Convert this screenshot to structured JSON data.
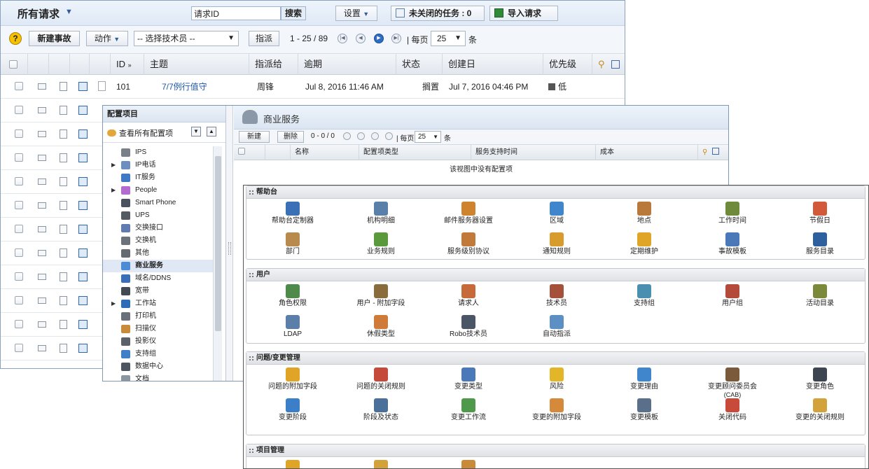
{
  "requests": {
    "title": "所有请求",
    "search_value": "请求ID",
    "search_button": "搜索",
    "settings_button": "设置",
    "tasks_button": "未关闭的任务 : 0",
    "import_button": "导入请求",
    "new_button": "新建事故",
    "action_button": "动作",
    "tech_select": "-- 选择技术员 --",
    "assign_button": "指派",
    "pager_range": "1 - 25 / 89",
    "per_page_label": "每页",
    "per_page_value": "25",
    "per_page_unit": "条",
    "columns": [
      "ID",
      "主题",
      "指派给",
      "逾期",
      "状态",
      "创建日",
      "优先级"
    ],
    "first_row": {
      "id": "101",
      "subject": "7/7例行值守",
      "assignee": "周锋",
      "due": "Jul 8, 2016 11:46 AM",
      "status": "搁置",
      "created": "Jul 7, 2016 04:46 PM",
      "priority": "低"
    },
    "row_count": 12
  },
  "ci": {
    "panel_title": "配置项目",
    "view_all": "查看所有配置项",
    "items": [
      {
        "label": "IPS",
        "expand": false,
        "color": "#7a7f88"
      },
      {
        "label": "IP电话",
        "expand": true,
        "color": "#6d8fbf"
      },
      {
        "label": "IT服务",
        "expand": false,
        "color": "#3d79c6"
      },
      {
        "label": "People",
        "expand": true,
        "color": "#b36ad1"
      },
      {
        "label": "Smart Phone",
        "expand": false,
        "color": "#4a5260"
      },
      {
        "label": "UPS",
        "expand": false,
        "color": "#555b63"
      },
      {
        "label": "交换接口",
        "expand": false,
        "color": "#5f7bb0"
      },
      {
        "label": "交换机",
        "expand": false,
        "color": "#6b727c"
      },
      {
        "label": "其他",
        "expand": false,
        "color": "#666b72"
      },
      {
        "label": "商业服务",
        "expand": false,
        "color": "#4c8bd6",
        "selected": true
      },
      {
        "label": "域名/DDNS",
        "expand": false,
        "color": "#3a6fb8"
      },
      {
        "label": "宽带",
        "expand": false,
        "color": "#444a52"
      },
      {
        "label": "工作站",
        "expand": true,
        "color": "#2f6cb8"
      },
      {
        "label": "打印机",
        "expand": false,
        "color": "#6a7079"
      },
      {
        "label": "扫描仪",
        "expand": false,
        "color": "#c98b3a"
      },
      {
        "label": "投影仪",
        "expand": false,
        "color": "#5b6169"
      },
      {
        "label": "支持组",
        "expand": false,
        "color": "#3f7fc7"
      },
      {
        "label": "数据中心",
        "expand": false,
        "color": "#4d5561"
      },
      {
        "label": "文档",
        "expand": false,
        "color": "#8b96a3"
      }
    ]
  },
  "business": {
    "title": "商业服务",
    "new_button": "新建",
    "delete_button": "删除",
    "pager_range": "0 - 0 / 0",
    "per_page_label": "每页",
    "per_page_value": "25",
    "per_page_unit": "条",
    "columns": [
      "名称",
      "配置项类型",
      "服务支持时间",
      "成本"
    ],
    "empty_text": "该视图中没有配置项"
  },
  "admin": {
    "sections": [
      {
        "title": "帮助台",
        "rows": [
          [
            {
              "label": "帮助台定制器",
              "color": "#3b6fb6"
            },
            {
              "label": "机构明细",
              "color": "#5a7fa8"
            },
            {
              "label": "邮件服务器设置",
              "color": "#d0832f"
            },
            {
              "label": "区域",
              "color": "#3f86cc"
            },
            {
              "label": "地点",
              "color": "#b8793a"
            },
            {
              "label": "工作时间",
              "color": "#6e8a3a"
            },
            {
              "label": "节假日",
              "color": "#d25a3a"
            }
          ],
          [
            {
              "label": "部门",
              "color": "#b98a4e"
            },
            {
              "label": "业务规则",
              "color": "#5a9a3d"
            },
            {
              "label": "服务级别协议",
              "color": "#c27a3a"
            },
            {
              "label": "通知规则",
              "color": "#d89b2e"
            },
            {
              "label": "定期维护",
              "color": "#e0a526"
            },
            {
              "label": "事故模板",
              "color": "#4a78b8"
            },
            {
              "label": "服务目录",
              "color": "#2e5f9e"
            }
          ]
        ]
      },
      {
        "title": "用户",
        "rows": [
          [
            {
              "label": "角色权限",
              "color": "#4e8b4a"
            },
            {
              "label": "用户 - 附加字段",
              "color": "#8a6c3c"
            },
            {
              "label": "请求人",
              "color": "#c66a3a"
            },
            {
              "label": "技术员",
              "color": "#a4503a"
            },
            {
              "label": "支持组",
              "color": "#4a8fb0"
            },
            {
              "label": "用户组",
              "color": "#b34a3a"
            },
            {
              "label": "活动目录",
              "color": "#7a8a3a"
            }
          ],
          [
            {
              "label": "LDAP",
              "color": "#5b7fa8"
            },
            {
              "label": "休假类型",
              "color": "#d07a3a"
            },
            {
              "label": "Robo技术员",
              "color": "#4a5666"
            },
            {
              "label": "自动指派",
              "color": "#5c8fc4"
            }
          ]
        ]
      },
      {
        "title": "问题/变更管理",
        "rows": [
          [
            {
              "label": "问题的附加字段",
              "color": "#e0a526"
            },
            {
              "label": "问题的关闭规则",
              "color": "#c54a3a"
            },
            {
              "label": "变更类型",
              "color": "#4a78b8"
            },
            {
              "label": "风险",
              "color": "#e3b528"
            },
            {
              "label": "变更理由",
              "color": "#3f86cc"
            },
            {
              "label": "变更顾问委员会",
              "label2": "(CAB)",
              "color": "#7a5a3a"
            },
            {
              "label": "变更角色",
              "color": "#3d4550"
            }
          ],
          [
            {
              "label": "变更阶段",
              "color": "#3a7fc8"
            },
            {
              "label": "阶段及状态",
              "color": "#4a6f9a"
            },
            {
              "label": "变更工作流",
              "color": "#4f9a4a"
            },
            {
              "label": "变更的附加字段",
              "color": "#d48a3a"
            },
            {
              "label": "变更模板",
              "color": "#5a6f8a"
            },
            {
              "label": "关闭代码",
              "color": "#c74a3a"
            },
            {
              "label": "变更的关闭规则",
              "color": "#d4a23a"
            }
          ]
        ]
      },
      {
        "title": "项目管理",
        "rows": [
          [
            {
              "label": "",
              "color": "#e0a526"
            },
            {
              "label": "",
              "color": "#d4a23a"
            },
            {
              "label": "",
              "color": "#c98b3a"
            }
          ]
        ]
      }
    ]
  }
}
